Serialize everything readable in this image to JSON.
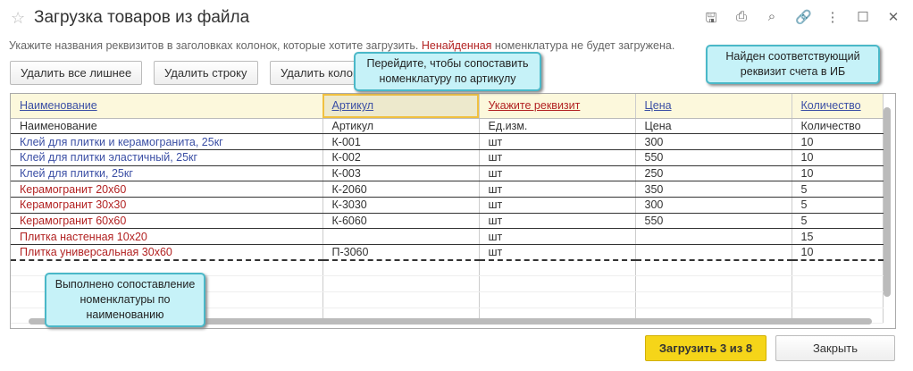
{
  "window": {
    "title": "Загрузка товаров из файла",
    "icons": [
      "save-icon",
      "print-icon",
      "preview-icon",
      "link-icon",
      "more-icon",
      "maximize-icon",
      "close-icon"
    ]
  },
  "hint": {
    "part1": "Укажите названия реквизитов в заголовках колонок, которые хотите загрузить. ",
    "red": "Ненайденная",
    "part2": " номенклатура не будет загружена."
  },
  "toolbar": {
    "delete_all": "Удалить все лишнее",
    "delete_row": "Удалить строку",
    "delete_col": "Удалить колонку"
  },
  "table": {
    "headers": [
      {
        "label": "Наименование",
        "red": false
      },
      {
        "label": "Артикул",
        "red": false
      },
      {
        "label": "Укажите реквизит",
        "red": true
      },
      {
        "label": "Цена",
        "red": false
      },
      {
        "label": "Количество",
        "red": false
      }
    ],
    "subheader": [
      "Наименование",
      "Артикул",
      "Ед.изм.",
      "Цена",
      "Количество"
    ],
    "rows": [
      {
        "cells": [
          "Клей для плитки и керамогранита, 25кг",
          "К-001",
          "шт",
          "300",
          "10"
        ],
        "found": true
      },
      {
        "cells": [
          "Клей для плитки эластичный, 25кг",
          "К-002",
          "шт",
          "550",
          "10"
        ],
        "found": true
      },
      {
        "cells": [
          "Клей для плитки, 25кг",
          "К-003",
          "шт",
          "250",
          "10"
        ],
        "found": true
      },
      {
        "cells": [
          "Керамогранит 20х60",
          "К-2060",
          "шт",
          "350",
          "5"
        ],
        "found": false
      },
      {
        "cells": [
          "Керамогранит 30х30",
          "К-3030",
          "шт",
          "300",
          "5"
        ],
        "found": false
      },
      {
        "cells": [
          "Керамогранит 60х60",
          "К-6060",
          "шт",
          "550",
          "5"
        ],
        "found": false
      },
      {
        "cells": [
          "Плитка настенная 10х20",
          "",
          "шт",
          "",
          "15"
        ],
        "found": false
      },
      {
        "cells": [
          "Плитка универсальная 30х60",
          "П-3060",
          "шт",
          "",
          "10"
        ],
        "found": false
      }
    ]
  },
  "callouts": {
    "article": "Перейдите, чтобы сопоставить номенклатуру по артикулу",
    "found": "Найден соответствующий реквизит счета в ИБ",
    "name": "Выполнено сопоставление номенклатуры по наименованию"
  },
  "footer": {
    "load": "Загрузить 3 из 8",
    "close": "Закрыть"
  },
  "colors": {
    "found": "#3b4fa5",
    "not_found": "#b22222",
    "accent": "#f5d519"
  }
}
